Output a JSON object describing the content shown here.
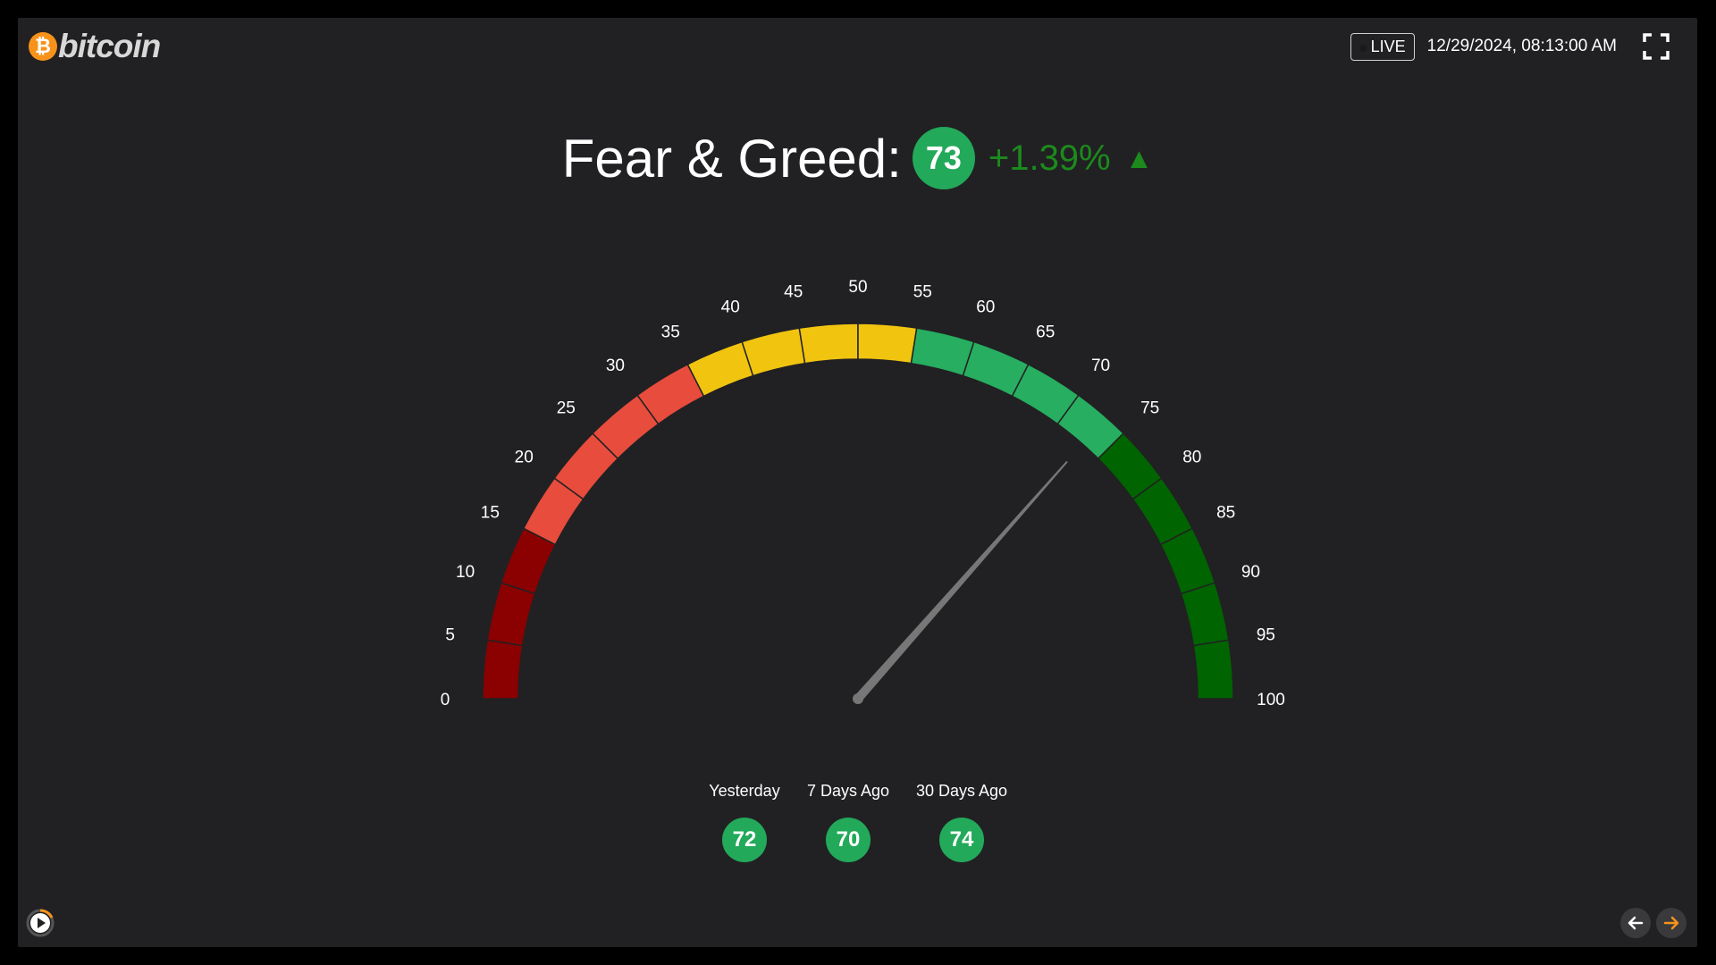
{
  "brand": {
    "name": "bitcoin",
    "mark": "₿"
  },
  "header": {
    "live_label": "LIVE",
    "datetime": "12/29/2024, 08:13:00 AM"
  },
  "headline": {
    "title": "Fear & Greed:",
    "score": "73",
    "change": "+1.39%",
    "change_arrow": "▲"
  },
  "gauge": {
    "min": 0,
    "max": 100,
    "value": 73,
    "tick_labels": [
      "0",
      "5",
      "10",
      "15",
      "20",
      "25",
      "30",
      "35",
      "40",
      "45",
      "50",
      "55",
      "60",
      "65",
      "70",
      "75",
      "80",
      "85",
      "90",
      "95",
      "100"
    ],
    "bands": [
      {
        "from": 0,
        "to": 15,
        "color": "#8b0000"
      },
      {
        "from": 15,
        "to": 35,
        "color": "#e74c3c"
      },
      {
        "from": 35,
        "to": 55,
        "color": "#f1c40f"
      },
      {
        "from": 55,
        "to": 75,
        "color": "#27ae60"
      },
      {
        "from": 75,
        "to": 100,
        "color": "#006400"
      }
    ],
    "needle_color": "#777777"
  },
  "history": [
    {
      "label": "Yesterday",
      "value": "72"
    },
    {
      "label": "7 Days Ago",
      "value": "70"
    },
    {
      "label": "30 Days Ago",
      "value": "74"
    }
  ],
  "colors": {
    "accent": "#f7931a",
    "positive": "#23a95a",
    "change_text": "#1c8a1c",
    "background": "#212123"
  }
}
